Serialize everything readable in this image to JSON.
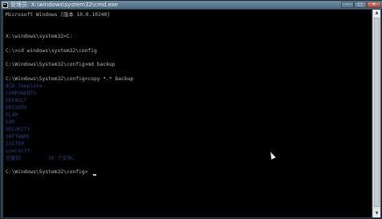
{
  "window": {
    "title": "管理员: X:\\windows\\system32\\cmd.exe",
    "buttons": {
      "minimize": "–",
      "maximize": "□",
      "close": "✕"
    }
  },
  "console": {
    "lines": [
      {
        "text": "Microsoft Windows [版本 10.0.10240]",
        "dim": false
      },
      {
        "text": "",
        "dim": false
      },
      {
        "text": "X:\\windows\\system32>C:",
        "dim": false
      },
      {
        "text": "",
        "dim": false
      },
      {
        "text": "C:\\>cd windows\\system32\\config",
        "dim": false
      },
      {
        "text": "",
        "dim": false
      },
      {
        "text": "C:\\Windows\\System32\\config>md backup",
        "dim": false
      },
      {
        "text": "",
        "dim": false
      },
      {
        "text": "C:\\Windows\\System32\\config>copy *.* backup",
        "dim": false
      },
      {
        "text": "BCD-Template",
        "dim": true
      },
      {
        "text": "COMPONENTS",
        "dim": true
      },
      {
        "text": "DEFAULT",
        "dim": true
      },
      {
        "text": "DRIVERS",
        "dim": true
      },
      {
        "text": "ELAM",
        "dim": true
      },
      {
        "text": "SAM",
        "dim": true
      },
      {
        "text": "SECURITY",
        "dim": true
      },
      {
        "text": "SOFTWARE",
        "dim": true
      },
      {
        "text": "SYSTEM",
        "dim": true
      },
      {
        "text": "userdiff",
        "dim": true
      },
      {
        "text": "已复制         10 个文件。",
        "dim": true
      },
      {
        "text": "",
        "dim": false
      },
      {
        "text": "C:\\Windows\\System32\\config>",
        "dim": false
      }
    ]
  }
}
